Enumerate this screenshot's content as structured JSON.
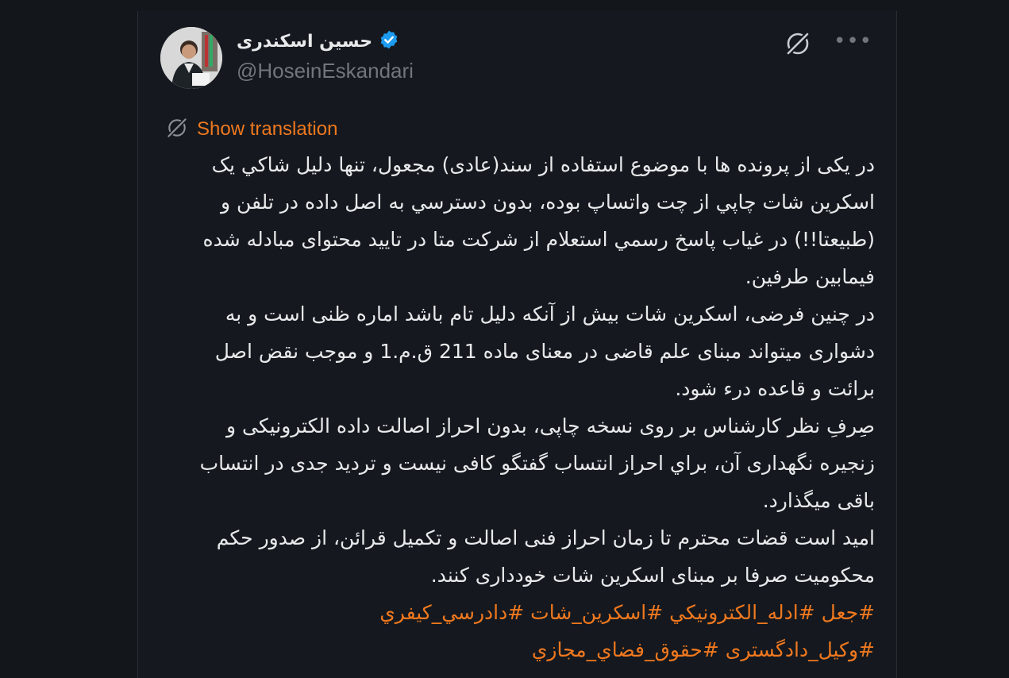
{
  "author": {
    "name": "حسین اسکندری",
    "handle": "@HoseinEskandari",
    "verified": true
  },
  "colors": {
    "accent": "#f0781e",
    "verified": "#1d9bf0",
    "text": "#e7e9ea",
    "muted": "#71767b",
    "background": "#15191f"
  },
  "icons": {
    "grok": "grok-icon",
    "more": "more-icon",
    "translate": "translate-icon",
    "verified": "verified-badge-icon"
  },
  "translation": {
    "label": "Show translation"
  },
  "tweet": {
    "paragraphs": [
      "در یکی از پرونده ها با موضوع استفاده از سند(عادی) مجعول، تنها دلیل شاکي یک اسکرین شات چاپي از چت واتساپ بوده، بدون دسترسي به اصل داده در تلفن و (طبیعتا!!) در غیاب پاسخ رسمي استعلام از شرکت متا در تایید محتوای مبادله شده فیمابین طرفین.",
      "در چنین فرضی، اسکرین شات بیش از آنکه دلیل تام باشد اماره ظنی است و به دشواری میتواند مبنای علم قاضی در معنای ماده 211 ق.م.1 و موجب نقض اصل برائت و قاعده درء شود.",
      "صِرفِ نظر کارشناس بر روی نسخه چاپی، بدون احراز اصالت داده الکترونیکی و زنجیره نگهداری آن، براي احراز انتساب گفتگو کافی نیست و تردید جدی در انتساب باقی میگذارد.",
      "امید است قضات محترم تا زمان احراز فنی اصالت و تکمیل قرائن، از صدور حکم محکومیت صرفا بر مبنای اسکرین شات خودداری کنند."
    ],
    "hashtags": [
      "#جعل",
      "#ادله_الکترونیکي",
      "#اسکرین_شات",
      "#دادرسي_کیفري",
      "#وکیل_دادگستری",
      "#حقوق_فضاي_مجازي"
    ]
  }
}
